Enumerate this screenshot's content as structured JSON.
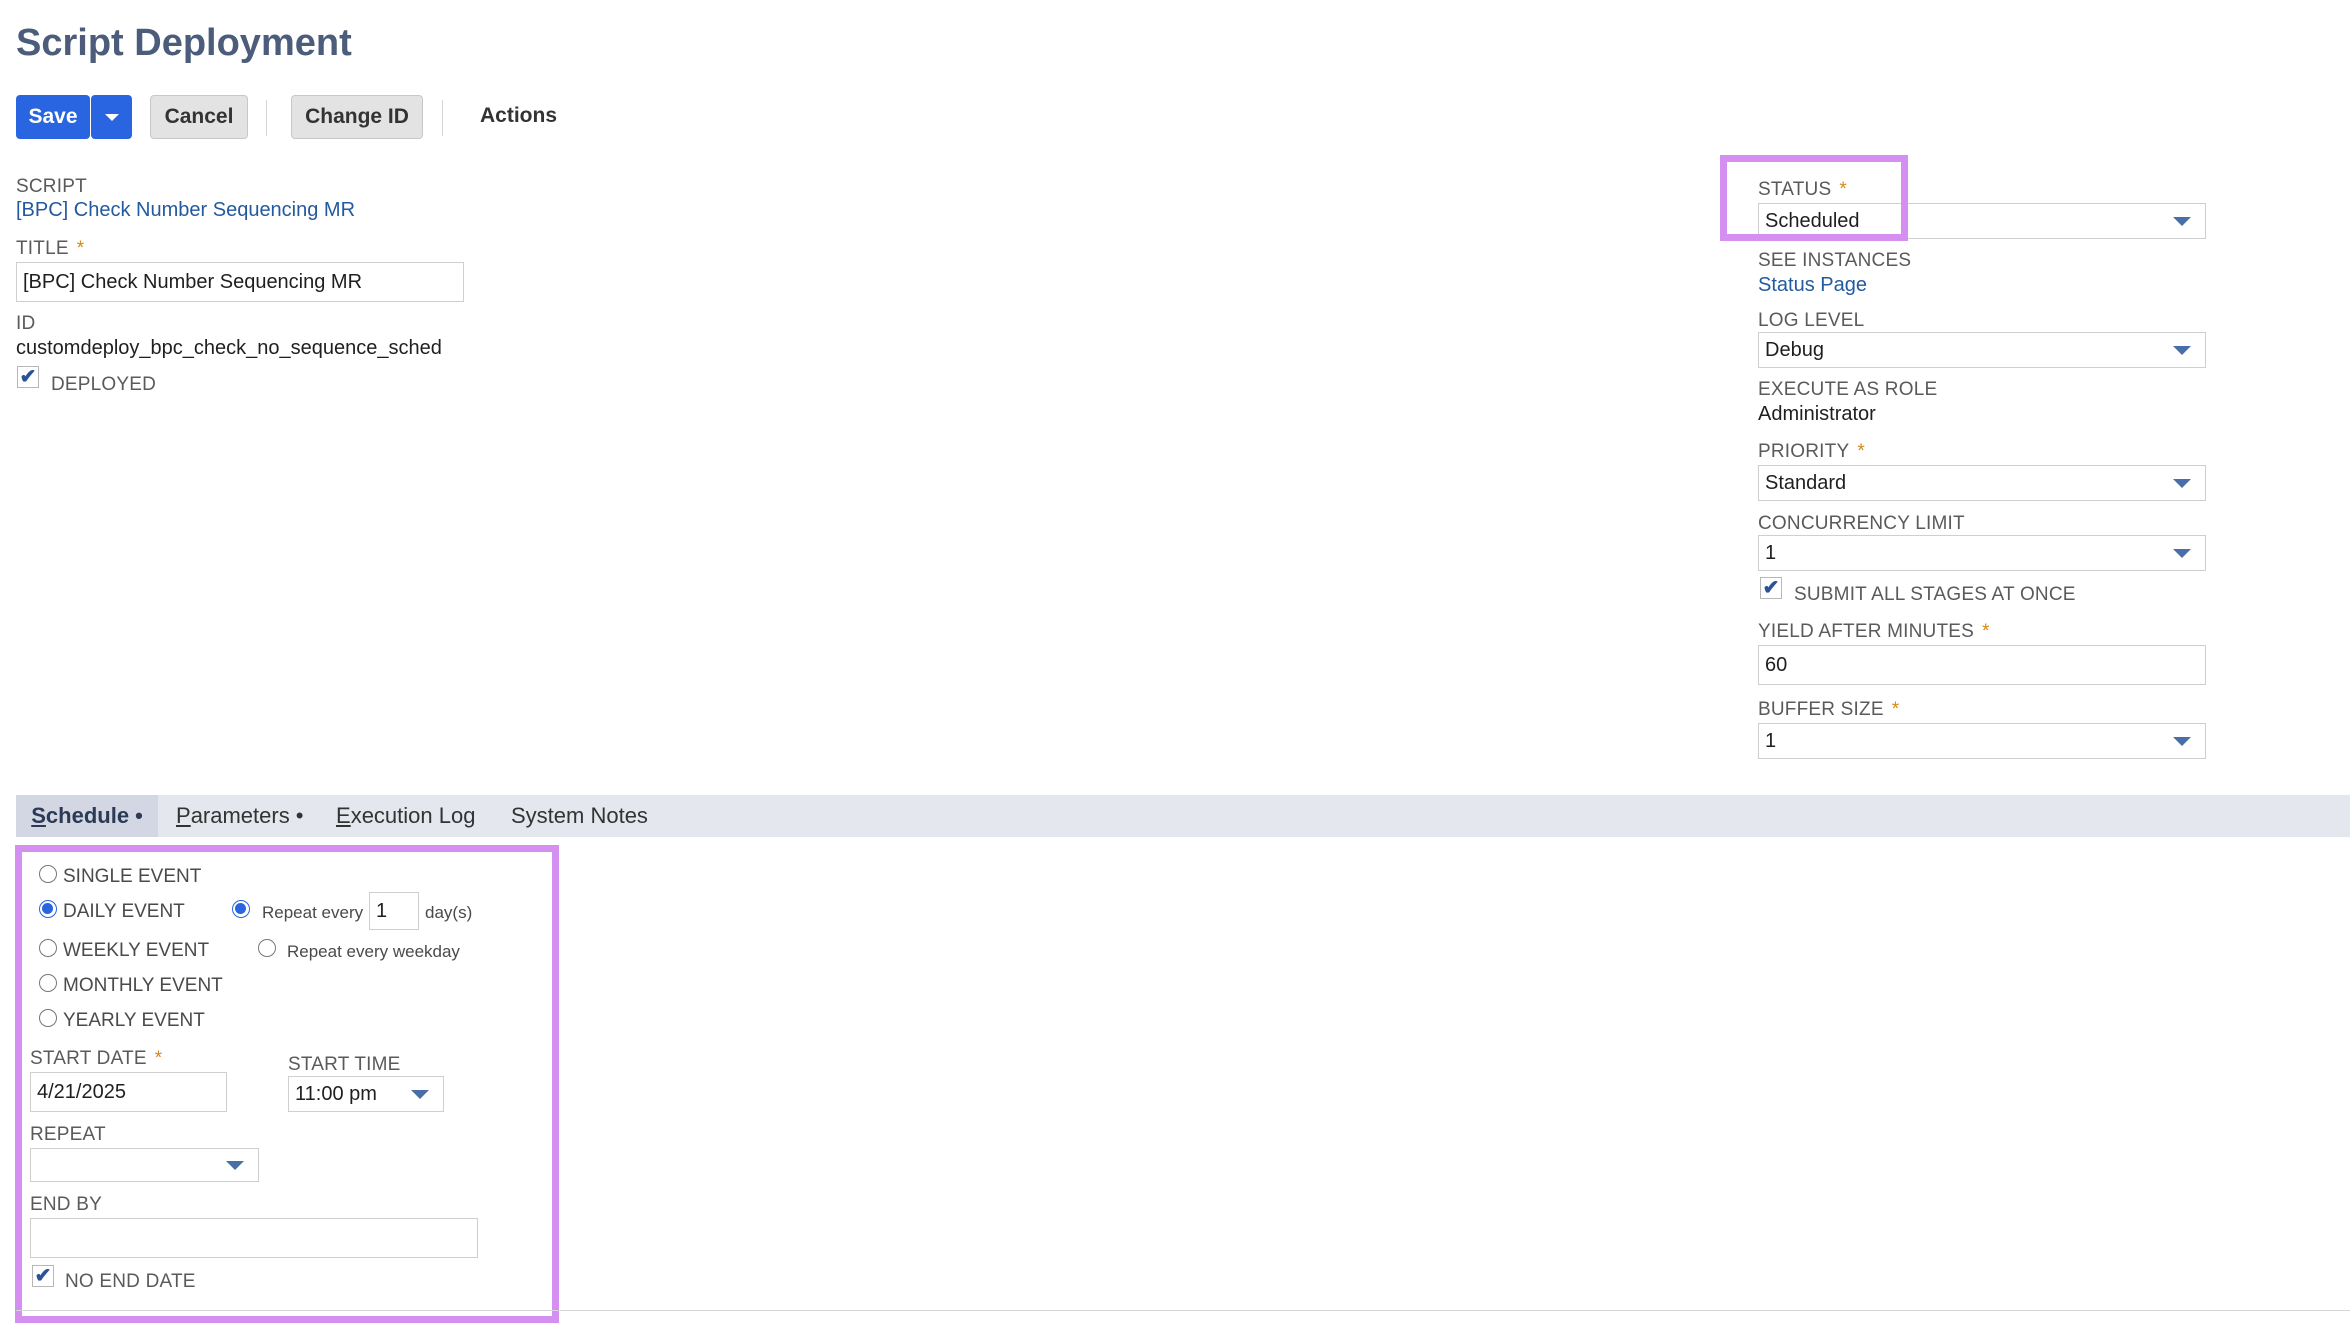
{
  "page": {
    "title": "Script Deployment"
  },
  "toolbar": {
    "save_label": "Save",
    "cancel_label": "Cancel",
    "change_id_label": "Change ID",
    "actions_label": "Actions"
  },
  "left_fields": {
    "script_label": "SCRIPT",
    "script_value": "[BPC] Check Number Sequencing MR",
    "title_label": "TITLE",
    "title_value": "[BPC] Check Number Sequencing MR",
    "id_label": "ID",
    "id_value": "customdeploy_bpc_check_no_sequence_sched",
    "deployed_label": "DEPLOYED",
    "deployed_checked": true
  },
  "right_fields": {
    "status_label": "STATUS",
    "status_value": "Scheduled",
    "see_instances_label": "SEE INSTANCES",
    "see_instances_link": "Status Page",
    "log_level_label": "LOG LEVEL",
    "log_level_value": "Debug",
    "execute_as_role_label": "EXECUTE AS ROLE",
    "execute_as_role_value": "Administrator",
    "priority_label": "PRIORITY",
    "priority_value": "Standard",
    "concurrency_label": "CONCURRENCY LIMIT",
    "concurrency_value": "1",
    "submit_all_label": "SUBMIT ALL STAGES AT ONCE",
    "submit_all_checked": true,
    "yield_label": "YIELD AFTER MINUTES",
    "yield_value": "60",
    "buffer_label": "BUFFER SIZE",
    "buffer_value": "1"
  },
  "required_mark": "*",
  "tabs": [
    {
      "first": "S",
      "rest": "chedule",
      "dot": "•"
    },
    {
      "first": "P",
      "rest": "arameters",
      "dot": "•"
    },
    {
      "first": "E",
      "rest": "xecution Log",
      "dot": ""
    },
    {
      "first": "",
      "rest": "System Notes",
      "dot": ""
    }
  ],
  "schedule": {
    "single_event": "SINGLE EVENT",
    "daily_event": "DAILY EVENT",
    "weekly_event": "WEEKLY EVENT",
    "monthly_event": "MONTHLY EVENT",
    "yearly_event": "YEARLY EVENT",
    "selected_event": "DAILY EVENT",
    "repeat_every_label": "Repeat every",
    "repeat_every_value": "1",
    "days_label": "day(s)",
    "repeat_every_weekday_label": "Repeat every weekday",
    "start_date_label": "START DATE",
    "start_date_value": "4/21/2025",
    "start_time_label": "START TIME",
    "start_time_value": "11:00 pm",
    "repeat_label": "REPEAT",
    "repeat_value": "",
    "end_by_label": "END BY",
    "end_by_value": "",
    "no_end_date_label": "NO END DATE",
    "no_end_date_checked": true
  },
  "colors": {
    "accent": "#2965e0",
    "highlight": "#d58ff0",
    "title": "#4b5d7a",
    "link": "#235a9e",
    "required": "#d28a19"
  }
}
